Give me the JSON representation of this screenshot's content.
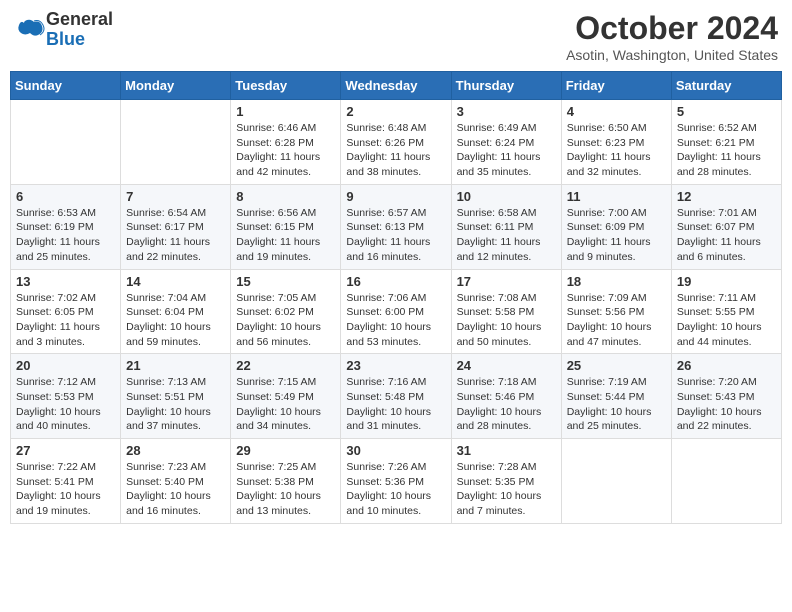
{
  "logo": {
    "general": "General",
    "blue": "Blue"
  },
  "title": "October 2024",
  "location": "Asotin, Washington, United States",
  "days_of_week": [
    "Sunday",
    "Monday",
    "Tuesday",
    "Wednesday",
    "Thursday",
    "Friday",
    "Saturday"
  ],
  "weeks": [
    [
      {
        "day": "",
        "sunrise": "",
        "sunset": "",
        "daylight": ""
      },
      {
        "day": "",
        "sunrise": "",
        "sunset": "",
        "daylight": ""
      },
      {
        "day": "1",
        "sunrise": "Sunrise: 6:46 AM",
        "sunset": "Sunset: 6:28 PM",
        "daylight": "Daylight: 11 hours and 42 minutes."
      },
      {
        "day": "2",
        "sunrise": "Sunrise: 6:48 AM",
        "sunset": "Sunset: 6:26 PM",
        "daylight": "Daylight: 11 hours and 38 minutes."
      },
      {
        "day": "3",
        "sunrise": "Sunrise: 6:49 AM",
        "sunset": "Sunset: 6:24 PM",
        "daylight": "Daylight: 11 hours and 35 minutes."
      },
      {
        "day": "4",
        "sunrise": "Sunrise: 6:50 AM",
        "sunset": "Sunset: 6:23 PM",
        "daylight": "Daylight: 11 hours and 32 minutes."
      },
      {
        "day": "5",
        "sunrise": "Sunrise: 6:52 AM",
        "sunset": "Sunset: 6:21 PM",
        "daylight": "Daylight: 11 hours and 28 minutes."
      }
    ],
    [
      {
        "day": "6",
        "sunrise": "Sunrise: 6:53 AM",
        "sunset": "Sunset: 6:19 PM",
        "daylight": "Daylight: 11 hours and 25 minutes."
      },
      {
        "day": "7",
        "sunrise": "Sunrise: 6:54 AM",
        "sunset": "Sunset: 6:17 PM",
        "daylight": "Daylight: 11 hours and 22 minutes."
      },
      {
        "day": "8",
        "sunrise": "Sunrise: 6:56 AM",
        "sunset": "Sunset: 6:15 PM",
        "daylight": "Daylight: 11 hours and 19 minutes."
      },
      {
        "day": "9",
        "sunrise": "Sunrise: 6:57 AM",
        "sunset": "Sunset: 6:13 PM",
        "daylight": "Daylight: 11 hours and 16 minutes."
      },
      {
        "day": "10",
        "sunrise": "Sunrise: 6:58 AM",
        "sunset": "Sunset: 6:11 PM",
        "daylight": "Daylight: 11 hours and 12 minutes."
      },
      {
        "day": "11",
        "sunrise": "Sunrise: 7:00 AM",
        "sunset": "Sunset: 6:09 PM",
        "daylight": "Daylight: 11 hours and 9 minutes."
      },
      {
        "day": "12",
        "sunrise": "Sunrise: 7:01 AM",
        "sunset": "Sunset: 6:07 PM",
        "daylight": "Daylight: 11 hours and 6 minutes."
      }
    ],
    [
      {
        "day": "13",
        "sunrise": "Sunrise: 7:02 AM",
        "sunset": "Sunset: 6:05 PM",
        "daylight": "Daylight: 11 hours and 3 minutes."
      },
      {
        "day": "14",
        "sunrise": "Sunrise: 7:04 AM",
        "sunset": "Sunset: 6:04 PM",
        "daylight": "Daylight: 10 hours and 59 minutes."
      },
      {
        "day": "15",
        "sunrise": "Sunrise: 7:05 AM",
        "sunset": "Sunset: 6:02 PM",
        "daylight": "Daylight: 10 hours and 56 minutes."
      },
      {
        "day": "16",
        "sunrise": "Sunrise: 7:06 AM",
        "sunset": "Sunset: 6:00 PM",
        "daylight": "Daylight: 10 hours and 53 minutes."
      },
      {
        "day": "17",
        "sunrise": "Sunrise: 7:08 AM",
        "sunset": "Sunset: 5:58 PM",
        "daylight": "Daylight: 10 hours and 50 minutes."
      },
      {
        "day": "18",
        "sunrise": "Sunrise: 7:09 AM",
        "sunset": "Sunset: 5:56 PM",
        "daylight": "Daylight: 10 hours and 47 minutes."
      },
      {
        "day": "19",
        "sunrise": "Sunrise: 7:11 AM",
        "sunset": "Sunset: 5:55 PM",
        "daylight": "Daylight: 10 hours and 44 minutes."
      }
    ],
    [
      {
        "day": "20",
        "sunrise": "Sunrise: 7:12 AM",
        "sunset": "Sunset: 5:53 PM",
        "daylight": "Daylight: 10 hours and 40 minutes."
      },
      {
        "day": "21",
        "sunrise": "Sunrise: 7:13 AM",
        "sunset": "Sunset: 5:51 PM",
        "daylight": "Daylight: 10 hours and 37 minutes."
      },
      {
        "day": "22",
        "sunrise": "Sunrise: 7:15 AM",
        "sunset": "Sunset: 5:49 PM",
        "daylight": "Daylight: 10 hours and 34 minutes."
      },
      {
        "day": "23",
        "sunrise": "Sunrise: 7:16 AM",
        "sunset": "Sunset: 5:48 PM",
        "daylight": "Daylight: 10 hours and 31 minutes."
      },
      {
        "day": "24",
        "sunrise": "Sunrise: 7:18 AM",
        "sunset": "Sunset: 5:46 PM",
        "daylight": "Daylight: 10 hours and 28 minutes."
      },
      {
        "day": "25",
        "sunrise": "Sunrise: 7:19 AM",
        "sunset": "Sunset: 5:44 PM",
        "daylight": "Daylight: 10 hours and 25 minutes."
      },
      {
        "day": "26",
        "sunrise": "Sunrise: 7:20 AM",
        "sunset": "Sunset: 5:43 PM",
        "daylight": "Daylight: 10 hours and 22 minutes."
      }
    ],
    [
      {
        "day": "27",
        "sunrise": "Sunrise: 7:22 AM",
        "sunset": "Sunset: 5:41 PM",
        "daylight": "Daylight: 10 hours and 19 minutes."
      },
      {
        "day": "28",
        "sunrise": "Sunrise: 7:23 AM",
        "sunset": "Sunset: 5:40 PM",
        "daylight": "Daylight: 10 hours and 16 minutes."
      },
      {
        "day": "29",
        "sunrise": "Sunrise: 7:25 AM",
        "sunset": "Sunset: 5:38 PM",
        "daylight": "Daylight: 10 hours and 13 minutes."
      },
      {
        "day": "30",
        "sunrise": "Sunrise: 7:26 AM",
        "sunset": "Sunset: 5:36 PM",
        "daylight": "Daylight: 10 hours and 10 minutes."
      },
      {
        "day": "31",
        "sunrise": "Sunrise: 7:28 AM",
        "sunset": "Sunset: 5:35 PM",
        "daylight": "Daylight: 10 hours and 7 minutes."
      },
      {
        "day": "",
        "sunrise": "",
        "sunset": "",
        "daylight": ""
      },
      {
        "day": "",
        "sunrise": "",
        "sunset": "",
        "daylight": ""
      }
    ]
  ]
}
